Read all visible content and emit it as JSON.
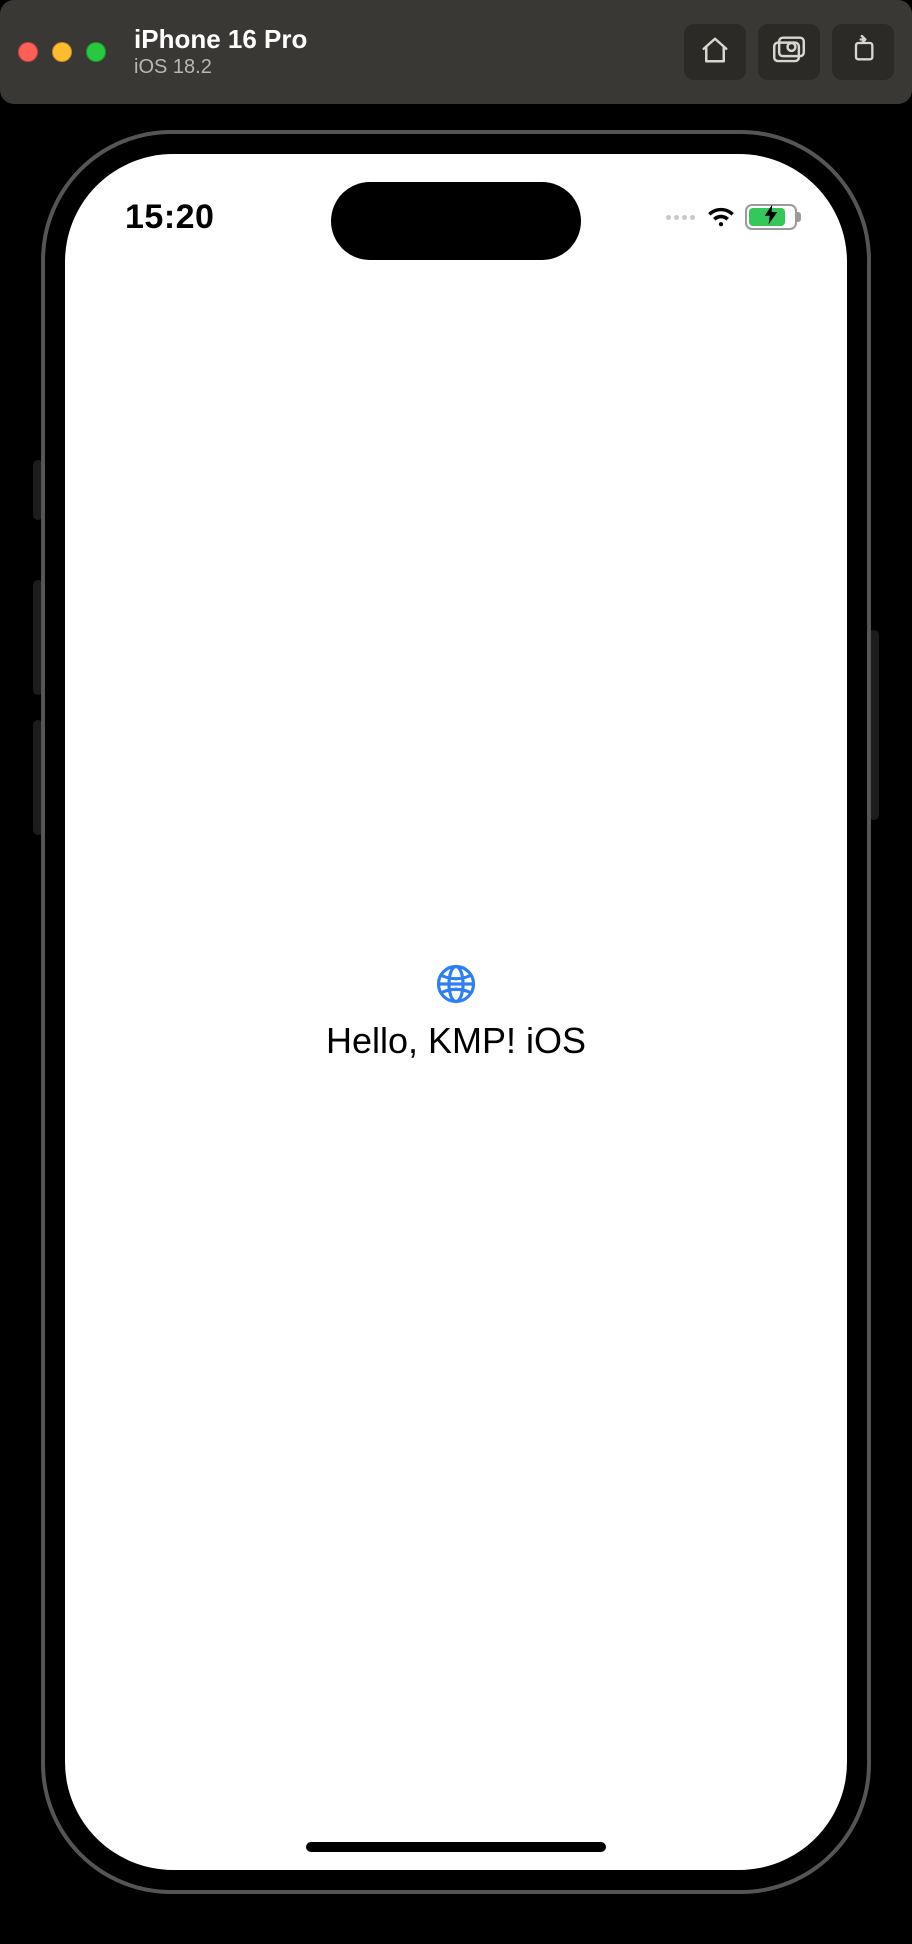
{
  "simulator": {
    "device_name": "iPhone 16 Pro",
    "os_version": "iOS 18.2",
    "toolbar": {
      "home": "home-icon",
      "screenshot": "camera-icon",
      "rotate": "rotate-icon"
    }
  },
  "status_bar": {
    "time": "15:20"
  },
  "content": {
    "icon": "globe-icon",
    "greeting": "Hello, KMP! iOS"
  },
  "colors": {
    "accent": "#2f7ff4",
    "battery_fill": "#34c759"
  }
}
